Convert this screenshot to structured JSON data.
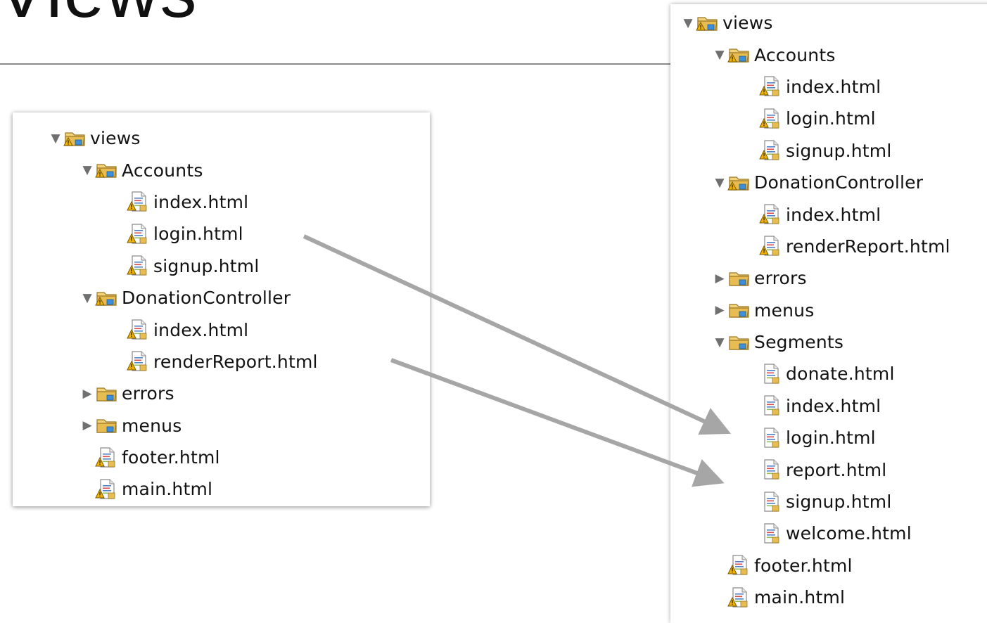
{
  "slide": {
    "title": "Views"
  },
  "left_tree": [
    {
      "label": "views",
      "type": "folder",
      "expanded": true,
      "depth": 0
    },
    {
      "label": "Accounts",
      "type": "folder",
      "expanded": true,
      "depth": 1
    },
    {
      "label": "index.html",
      "type": "file",
      "depth": 2
    },
    {
      "label": "login.html",
      "type": "file",
      "depth": 2
    },
    {
      "label": "signup.html",
      "type": "file",
      "depth": 2
    },
    {
      "label": "DonationController",
      "type": "folder",
      "expanded": true,
      "depth": 1
    },
    {
      "label": "index.html",
      "type": "file",
      "depth": 2
    },
    {
      "label": "renderReport.html",
      "type": "file",
      "depth": 2
    },
    {
      "label": "errors",
      "type": "folder-plain",
      "expanded": false,
      "depth": 1
    },
    {
      "label": "menus",
      "type": "folder-plain",
      "expanded": false,
      "depth": 1
    },
    {
      "label": "footer.html",
      "type": "file",
      "depth": 1
    },
    {
      "label": "main.html",
      "type": "file",
      "depth": 1
    }
  ],
  "right_tree": [
    {
      "label": "views",
      "type": "folder",
      "expanded": true,
      "depth": 0
    },
    {
      "label": "Accounts",
      "type": "folder",
      "expanded": true,
      "depth": 1
    },
    {
      "label": "index.html",
      "type": "file",
      "depth": 2
    },
    {
      "label": "login.html",
      "type": "file",
      "depth": 2
    },
    {
      "label": "signup.html",
      "type": "file",
      "depth": 2
    },
    {
      "label": "DonationController",
      "type": "folder",
      "expanded": true,
      "depth": 1
    },
    {
      "label": "index.html",
      "type": "file",
      "depth": 2
    },
    {
      "label": "renderReport.html",
      "type": "file",
      "depth": 2
    },
    {
      "label": "errors",
      "type": "folder-plain",
      "expanded": false,
      "depth": 1
    },
    {
      "label": "menus",
      "type": "folder-plain",
      "expanded": false,
      "depth": 1
    },
    {
      "label": "Segments",
      "type": "folder-plain",
      "expanded": true,
      "depth": 1
    },
    {
      "label": "donate.html",
      "type": "file-plain",
      "depth": 2
    },
    {
      "label": "index.html",
      "type": "file-plain",
      "depth": 2
    },
    {
      "label": "login.html",
      "type": "file-plain",
      "depth": 2
    },
    {
      "label": "report.html",
      "type": "file-plain",
      "depth": 2
    },
    {
      "label": "signup.html",
      "type": "file-plain",
      "depth": 2
    },
    {
      "label": "welcome.html",
      "type": "file-plain",
      "depth": 2
    },
    {
      "label": "footer.html",
      "type": "file",
      "depth": 1
    },
    {
      "label": "main.html",
      "type": "file",
      "depth": 1
    }
  ],
  "icons": {
    "folder": "warning-folder-icon",
    "folder-plain": "folder-icon",
    "file": "warning-html-file-icon",
    "file-plain": "html-file-icon"
  },
  "colors": {
    "arrow": "#a6a6a6",
    "twisty": "#707070",
    "folder": "#e7bd53",
    "warning": "#f0b400"
  }
}
